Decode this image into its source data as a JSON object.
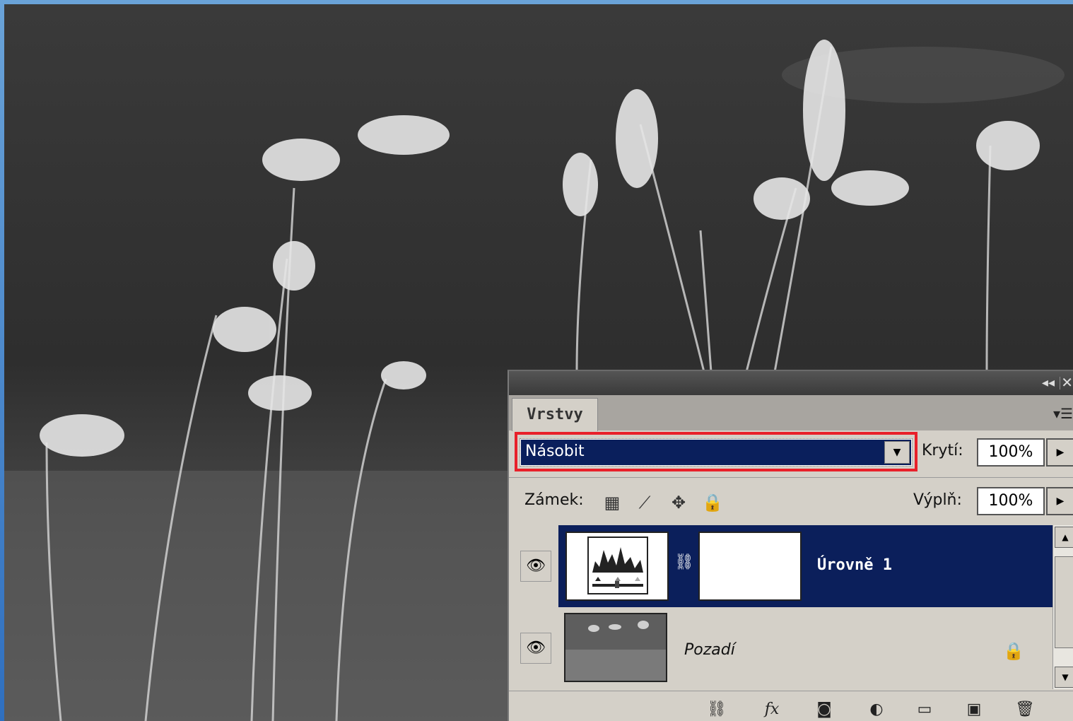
{
  "panel": {
    "tab_label": "Vrstvy",
    "blend_mode": "Násobit",
    "opacity_label": "Krytí:",
    "opacity_value": "100%",
    "lock_label": "Zámek:",
    "fill_label": "Výplň:",
    "fill_value": "100%",
    "layers": [
      {
        "name": "Úrovně 1",
        "selected": true,
        "type": "adjustment-levels"
      },
      {
        "name": "Pozadí",
        "selected": false,
        "type": "image",
        "locked": true
      }
    ]
  },
  "colors": {
    "selection": "#0b1f5b",
    "highlight_border": "#e8202a",
    "panel_bg": "#d4d0c8"
  }
}
